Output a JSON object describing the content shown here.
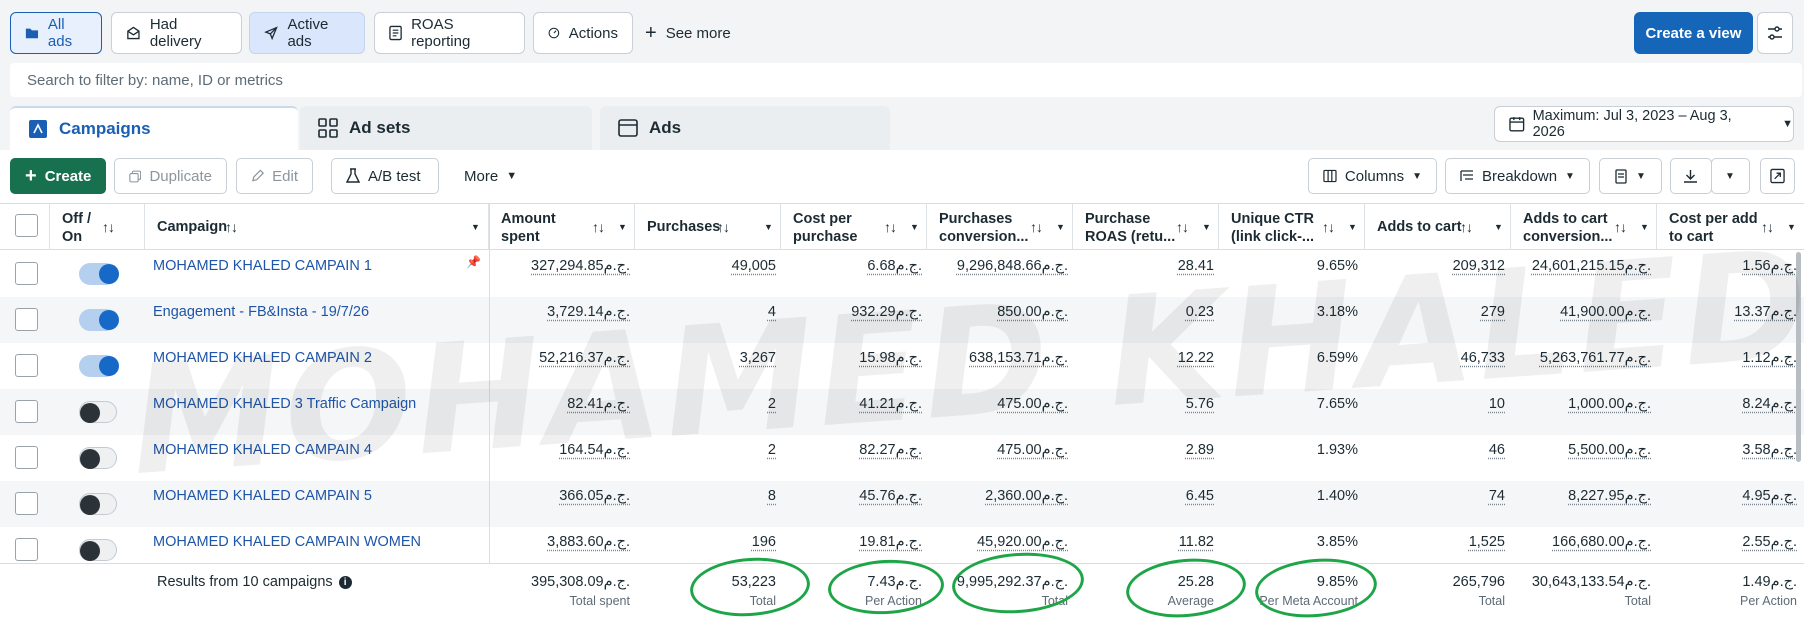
{
  "presets": [
    {
      "label": "All ads",
      "icon": "folder-icon"
    },
    {
      "label": "Had delivery",
      "icon": "inbox-icon"
    },
    {
      "label": "Active ads",
      "icon": "paper-plane-icon"
    },
    {
      "label": "ROAS reporting",
      "icon": "report-icon"
    },
    {
      "label": "Actions",
      "icon": "gauge-icon"
    }
  ],
  "see_more": "See more",
  "create_view": "Create a view",
  "search": {
    "placeholder": "Search to filter by: name, ID or metrics"
  },
  "level_tabs": {
    "campaigns": "Campaigns",
    "adsets": "Ad sets",
    "ads": "Ads"
  },
  "date_range": "Maximum: Jul 3, 2023 – Aug 3, 2026",
  "toolbar": {
    "create": "Create",
    "duplicate": "Duplicate",
    "edit": "Edit",
    "ab_test": "A/B test",
    "more": "More",
    "columns": "Columns",
    "breakdown": "Breakdown"
  },
  "columns": {
    "off_on": [
      "Off /",
      "On"
    ],
    "campaign": "Campaign",
    "amount_spent": [
      "Amount",
      "spent"
    ],
    "purchases": "Purchases",
    "cost_per_purchase": [
      "Cost per",
      "purchase"
    ],
    "purchases_conversion": [
      "Purchases",
      "conversion..."
    ],
    "purchase_roas": [
      "Purchase",
      "ROAS (retu..."
    ],
    "unique_ctr": [
      "Unique CTR",
      "(link click-..."
    ],
    "adds_to_cart": "Adds to cart",
    "adds_to_cart_conversion": [
      "Adds to cart",
      "conversion..."
    ],
    "cost_per_add": [
      "Cost per add",
      "to cart"
    ]
  },
  "rows": [
    {
      "name": "MOHAMED KHALED CAMPAIN 1",
      "on": true,
      "spent": "327,294.85ج.م.",
      "purchases": "49,005",
      "cpp": "6.68ج.م.",
      "conv": "9,296,848.66ج.م.",
      "roas": "28.41",
      "ctr": "9.65%",
      "atc": "209,312",
      "atc_conv": "24,601,215.15ج.م.",
      "cpa": "1.56ج.م."
    },
    {
      "name": "Engagement - FB&Insta - 19/7/26",
      "on": true,
      "spent": "3,729.14ج.م.",
      "purchases": "4",
      "cpp": "932.29ج.م.",
      "conv": "850.00ج.م.",
      "roas": "0.23",
      "ctr": "3.18%",
      "atc": "279",
      "atc_conv": "41,900.00ج.م.",
      "cpa": "13.37ج.م."
    },
    {
      "name": "MOHAMED KHALED CAMPAIN 2",
      "on": true,
      "spent": "52,216.37ج.م.",
      "purchases": "3,267",
      "cpp": "15.98ج.م.",
      "conv": "638,153.71ج.م.",
      "roas": "12.22",
      "ctr": "6.59%",
      "atc": "46,733",
      "atc_conv": "5,263,761.77ج.م.",
      "cpa": "1.12ج.م."
    },
    {
      "name": "MOHAMED KHALED 3 Traffic Campaign",
      "on": false,
      "spent": "82.41ج.م.",
      "purchases": "2",
      "cpp": "41.21ج.م.",
      "conv": "475.00ج.م.",
      "roas": "5.76",
      "ctr": "7.65%",
      "atc": "10",
      "atc_conv": "1,000.00ج.م.",
      "cpa": "8.24ج.م."
    },
    {
      "name": "MOHAMED KHALED CAMPAIN 4",
      "on": false,
      "spent": "164.54ج.م.",
      "purchases": "2",
      "cpp": "82.27ج.م.",
      "conv": "475.00ج.م.",
      "roas": "2.89",
      "ctr": "1.93%",
      "atc": "46",
      "atc_conv": "5,500.00ج.م.",
      "cpa": "3.58ج.م."
    },
    {
      "name": "MOHAMED KHALED CAMPAIN 5",
      "on": false,
      "spent": "366.05ج.م.",
      "purchases": "8",
      "cpp": "45.76ج.م.",
      "conv": "2,360.00ج.م.",
      "roas": "6.45",
      "ctr": "1.40%",
      "atc": "74",
      "atc_conv": "8,227.95ج.م.",
      "cpa": "4.95ج.م."
    },
    {
      "name": "MOHAMED KHALED CAMPAIN WOMEN",
      "on": false,
      "spent": "3,883.60ج.م.",
      "purchases": "196",
      "cpp": "19.81ج.م.",
      "conv": "45,920.00ج.م.",
      "roas": "11.82",
      "ctr": "3.85%",
      "atc": "1,525",
      "atc_conv": "166,680.00ج.م.",
      "cpa": "2.55ج.م."
    }
  ],
  "summary": {
    "label": "Results from 10 campaigns",
    "spent": "395,308.09ج.م.",
    "spent_sub": "Total spent",
    "purchases": "53,223",
    "purchases_sub": "Total",
    "cpp": "7.43ج.م.",
    "cpp_sub": "Per Action",
    "conv": "9,995,292.37ج.م.",
    "conv_sub": "Total",
    "roas": "25.28",
    "roas_sub": "Average",
    "ctr": "9.85%",
    "ctr_sub": "Per Meta Account",
    "atc": "265,796",
    "atc_sub": "Total",
    "atc_conv": "30,643,133.54ج.م.",
    "atc_conv_sub": "Total",
    "cpa": "1.49ج.م.",
    "cpa_sub": "Per Action"
  },
  "watermark": "MOHAMED KHALED",
  "colors": {
    "primary": "#1565b8",
    "create_green": "#17714e",
    "link": "#1e55a8",
    "highlight_ring": "#1ea548"
  }
}
